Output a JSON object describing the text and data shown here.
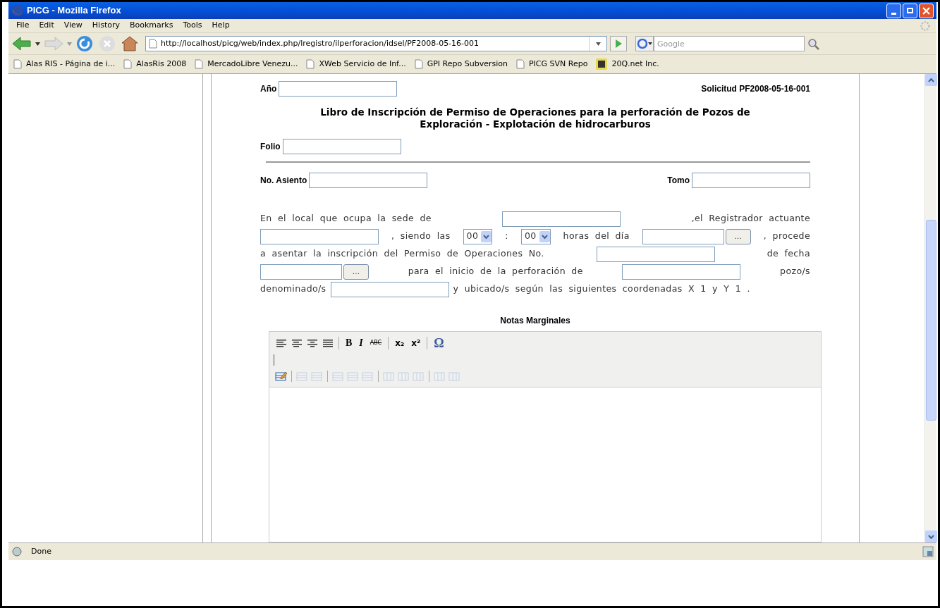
{
  "window": {
    "title": "PICG - Mozilla Firefox"
  },
  "menu": [
    "File",
    "Edit",
    "View",
    "History",
    "Bookmarks",
    "Tools",
    "Help"
  ],
  "address_bar": {
    "value": "http://localhost/picg/web/index.php/lregistro/ilperforacion/idsel/PF2008-05-16-001"
  },
  "search": {
    "placeholder": "Google"
  },
  "bookmarks": [
    {
      "label": "Alas RIS - Página de i...",
      "kind": "page"
    },
    {
      "label": "AlasRis 2008",
      "kind": "page"
    },
    {
      "label": "MercadoLibre Venezu...",
      "kind": "page"
    },
    {
      "label": "XWeb Servicio de Inf...",
      "kind": "page"
    },
    {
      "label": "GPI Repo Subversion",
      "kind": "page"
    },
    {
      "label": "PICG SVN Repo",
      "kind": "page"
    },
    {
      "label": "20Q.net Inc.",
      "kind": "site"
    }
  ],
  "form": {
    "year_label": "Año",
    "request": "Solicitud PF2008-05-16-001",
    "title": "Libro de Inscripción de Permiso de Operaciones para la perforación de Pozos de Exploración - Explotación de hidrocarburos",
    "folio_label": "Folio",
    "seat_label": "No. Asiento",
    "volume_label": "Tomo",
    "paragraph": [
      [
        {
          "kind": "text",
          "text": "En el local que ocupa la sede de"
        },
        {
          "kind": "input"
        },
        {
          "kind": "text",
          "text": ",el Registrador actuante"
        }
      ],
      [
        {
          "kind": "input"
        },
        {
          "kind": "text",
          "text": ", siendo las"
        },
        {
          "kind": "select",
          "value": "00"
        },
        {
          "kind": "text",
          "text": ":"
        },
        {
          "kind": "select",
          "value": "00"
        },
        {
          "kind": "text",
          "text": "horas del día"
        },
        {
          "kind": "date",
          "button": "..."
        },
        {
          "kind": "text",
          "text": ", procede"
        }
      ],
      [
        {
          "kind": "text",
          "text": "a asentar la inscripción del Permiso de Operaciones No."
        },
        {
          "kind": "input"
        },
        {
          "kind": "text",
          "text": "de fecha"
        }
      ],
      [
        {
          "kind": "date",
          "button": "..."
        },
        {
          "kind": "text",
          "text": "para el inicio de la perforación de"
        },
        {
          "kind": "input"
        },
        {
          "kind": "text",
          "text": "pozo/s"
        }
      ],
      [
        {
          "kind": "text",
          "text": "denominado/s"
        },
        {
          "kind": "input"
        },
        {
          "kind": "text",
          "text": "y ubicado/s según las siguientes coordenadas X 1 y Y 1 ."
        }
      ]
    ],
    "notes_title": "Notas Marginales",
    "editor_buttons": [
      {
        "kind": "align-left"
      },
      {
        "kind": "align-center"
      },
      {
        "kind": "align-right"
      },
      {
        "kind": "align-justify"
      },
      {
        "kind": "sep"
      },
      {
        "kind": "bold",
        "text": "B"
      },
      {
        "kind": "italic",
        "text": "I"
      },
      {
        "kind": "strikethrough",
        "text": "ABC"
      },
      {
        "kind": "sep"
      },
      {
        "kind": "subscript",
        "text": "x₂"
      },
      {
        "kind": "superscript",
        "text": "x²"
      },
      {
        "kind": "sep"
      },
      {
        "kind": "symbol",
        "text": "Ω"
      }
    ],
    "table_buttons": [
      {
        "kind": "table",
        "disabled": false
      },
      {
        "kind": "sep"
      },
      {
        "kind": "row",
        "disabled": true
      },
      {
        "kind": "row",
        "disabled": true
      },
      {
        "kind": "sep"
      },
      {
        "kind": "row",
        "disabled": true
      },
      {
        "kind": "row",
        "disabled": true
      },
      {
        "kind": "row",
        "disabled": true
      },
      {
        "kind": "sep"
      },
      {
        "kind": "col",
        "disabled": true
      },
      {
        "kind": "col",
        "disabled": true
      },
      {
        "kind": "col",
        "disabled": true
      },
      {
        "kind": "sep"
      },
      {
        "kind": "col",
        "disabled": true
      },
      {
        "kind": "col",
        "disabled": true
      }
    ]
  },
  "status_bar": {
    "text": "Done"
  }
}
